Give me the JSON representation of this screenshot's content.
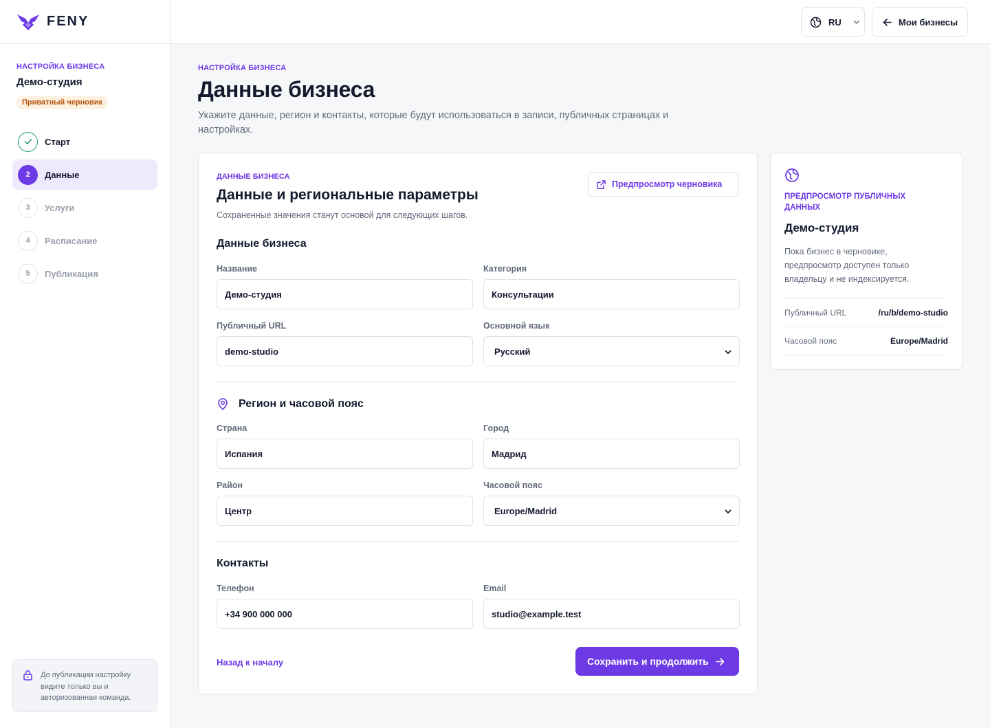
{
  "app": {
    "name": "FENY"
  },
  "sidebar": {
    "eyebrow": "НАСТРОЙКА БИЗНЕСА",
    "business_name": "Демо-студия",
    "status_badge": "Приватный черновик",
    "steps": [
      {
        "number": "",
        "label": "Старт",
        "state": "done"
      },
      {
        "number": "2",
        "label": "Данные",
        "state": "active"
      },
      {
        "number": "3",
        "label": "Услуги",
        "state": "pending"
      },
      {
        "number": "4",
        "label": "Расписание",
        "state": "pending"
      },
      {
        "number": "5",
        "label": "Публикация",
        "state": "pending"
      }
    ],
    "note": "До публикации настройку видите только вы и авторизованная команда."
  },
  "topbar": {
    "language": "RU",
    "my_businesses": "Мои бизнесы"
  },
  "header": {
    "eyebrow": "НАСТРОЙКА БИЗНЕСА",
    "title": "Данные бизнеса",
    "subtitle": "Укажите данные, регион и контакты, которые будут использоваться в записи, публичных страницах и настройках."
  },
  "form": {
    "eyebrow": "ДАННЫЕ БИЗНЕСА",
    "title": "Данные и региональные параметры",
    "subtitle": "Сохраненные значения станут основой для следующих шагов.",
    "preview_button": "Предпросмотр черновика",
    "section_business": "Данные бизнеса",
    "name_label": "Название",
    "name_value": "Демо-студия",
    "category_label": "Категория",
    "category_value": "Консультации",
    "url_label": "Публичный URL",
    "url_value": "demo-studio",
    "language_label": "Основной язык",
    "language_value": "Русский",
    "section_region": "Регион и часовой пояс",
    "country_label": "Страна",
    "country_value": "Испания",
    "city_label": "Город",
    "city_value": "Мадрид",
    "district_label": "Район",
    "district_value": "Центр",
    "timezone_label": "Часовой пояс",
    "timezone_value": "Europe/Madrid",
    "section_contacts": "Контакты",
    "phone_label": "Телефон",
    "phone_value": "+34 900 000 000",
    "email_label": "Email",
    "email_value": "studio@example.test",
    "back_link": "Назад к началу",
    "save_button": "Сохранить и продолжить"
  },
  "preview": {
    "eyebrow": "ПРЕДПРОСМОТР ПУБЛИЧНЫХ ДАННЫХ",
    "title": "Демо-студия",
    "text": "Пока бизнес в черновике, предпросмотр доступен только владельцу и не индексируется.",
    "rows": [
      {
        "key": "Публичный URL",
        "value": "/ru/b/demo-studio"
      },
      {
        "key": "Часовой пояс",
        "value": "Europe/Madrid"
      }
    ]
  },
  "colors": {
    "accent": "#6d3ae6",
    "success": "#2f9e6f",
    "badge_bg": "#fdf1e1",
    "badge_text": "#b5520b"
  }
}
